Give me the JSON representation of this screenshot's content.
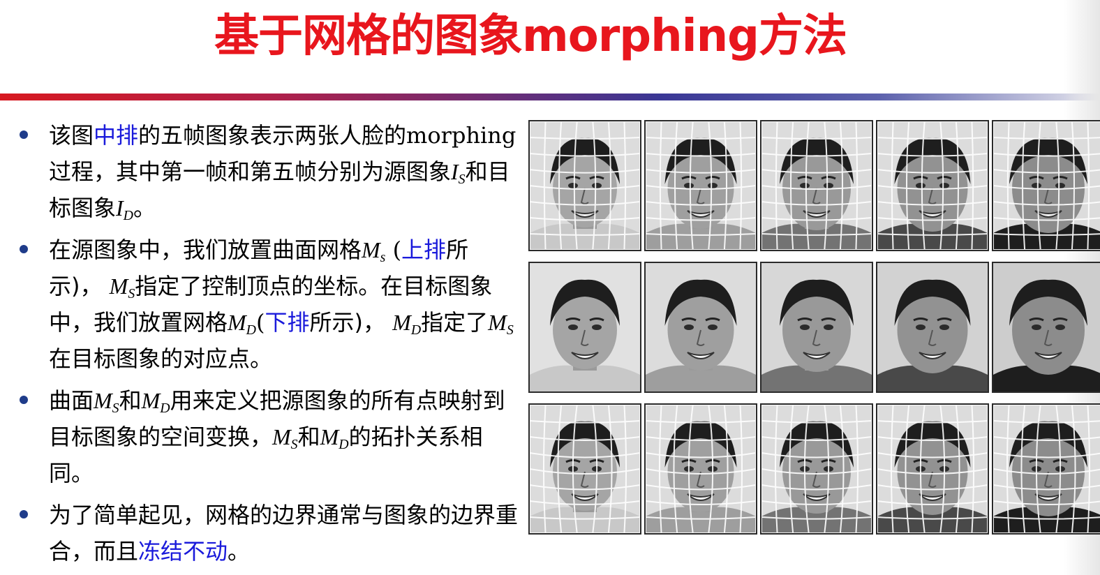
{
  "title": "基于网格的图象morphing方法",
  "bullets": [
    {
      "p1_a": "该图",
      "p1_hl": "中排",
      "p1_b": "的五帧图象表示两张人脸的",
      "p1_morph": "morphing",
      "p1_c": "过程，其中第一帧和第五帧分别为源图象",
      "var_I": "I",
      "sub_S": "S",
      "p1_d": "和目标图象",
      "sub_D": "D",
      "p1_e": "。"
    },
    {
      "p2_a": "在源图象中，我们放置曲面网格",
      "var_M": "M",
      "sub_s_lower": "s",
      "p2_paren_open": " (",
      "p2_hl_top": "上排",
      "p2_b": "所示)，",
      "sub_S": "S",
      "p2_c": "指定了控制顶点的坐标。在目标图象中，我们放置网格",
      "sub_D": "D",
      "p2_paren2": "(",
      "p2_hl_bottom": "下排",
      "p2_d": "所示)，",
      "p2_e": "指定了",
      "p2_f": "在目标图象的对应点。"
    },
    {
      "p3_a": "曲面",
      "p3_b": "和",
      "p3_c": "用来定义把源图象的所有点映射到目标图象的空间变换，",
      "p3_d": "的拓扑关系相同。"
    },
    {
      "p4_a": "为了简单起见，网格的边界通常与图象的边界重合，而且",
      "p4_hl": "冻结不动",
      "p4_b": "。"
    }
  ],
  "figure": {
    "rows": [
      "source-mesh-row",
      "morph-sequence-row",
      "target-mesh-row"
    ],
    "columns": 5
  }
}
